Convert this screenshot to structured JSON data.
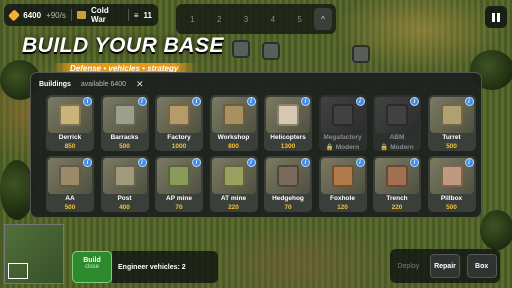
{
  "hud": {
    "gold": "6400",
    "rate": "+90/s",
    "faction": "Cold War",
    "level": "11",
    "slots": [
      "1",
      "2",
      "3",
      "4",
      "5"
    ],
    "slots_up": "^"
  },
  "banner": {
    "title": "BUILD YOUR BASE",
    "subtitle": "Defense • vehicles • strategy"
  },
  "panel": {
    "title": "Buildings",
    "available": "available 6400",
    "close": "✕",
    "info": "i",
    "buildings": [
      {
        "name": "Derrick",
        "price": "850",
        "icon": "derrick-icon"
      },
      {
        "name": "Barracks",
        "price": "500",
        "icon": "barracks-icon"
      },
      {
        "name": "Factory",
        "price": "1000",
        "icon": "factory-icon"
      },
      {
        "name": "Workshop",
        "price": "800",
        "icon": "workshop-icon"
      },
      {
        "name": "Helicopters",
        "price": "1300",
        "icon": "helicopters-icon"
      },
      {
        "name": "Megafactory",
        "price": "🔒 Modern",
        "icon": "megafactory-icon",
        "locked": true
      },
      {
        "name": "ABM",
        "price": "🔒 Modern",
        "icon": "abm-icon",
        "locked": true
      },
      {
        "name": "Turret",
        "price": "500",
        "icon": "turret-icon"
      },
      {
        "name": "AA",
        "price": "500",
        "icon": "aa-icon"
      },
      {
        "name": "Post",
        "price": "400",
        "icon": "post-icon"
      },
      {
        "name": "AP mine",
        "price": "70",
        "icon": "ap-mine-icon"
      },
      {
        "name": "AT mine",
        "price": "220",
        "icon": "at-mine-icon"
      },
      {
        "name": "Hedgehog",
        "price": "70",
        "icon": "hedgehog-icon"
      },
      {
        "name": "Foxhole",
        "price": "120",
        "icon": "foxhole-icon"
      },
      {
        "name": "Trench",
        "price": "220",
        "icon": "trench-icon"
      },
      {
        "name": "Pillbox",
        "price": "500",
        "icon": "pillbox-icon"
      }
    ]
  },
  "bottom": {
    "build_label": "Build",
    "build_sub": "close",
    "engineer": "Engineer vehicles: 2",
    "deploy": "Deploy",
    "repair": "Repair",
    "box": "Box"
  },
  "colors": {
    "accent": "#e39a1b",
    "price": "#f3c23a",
    "build": "#2d8a2d",
    "info": "#3d8be8"
  }
}
